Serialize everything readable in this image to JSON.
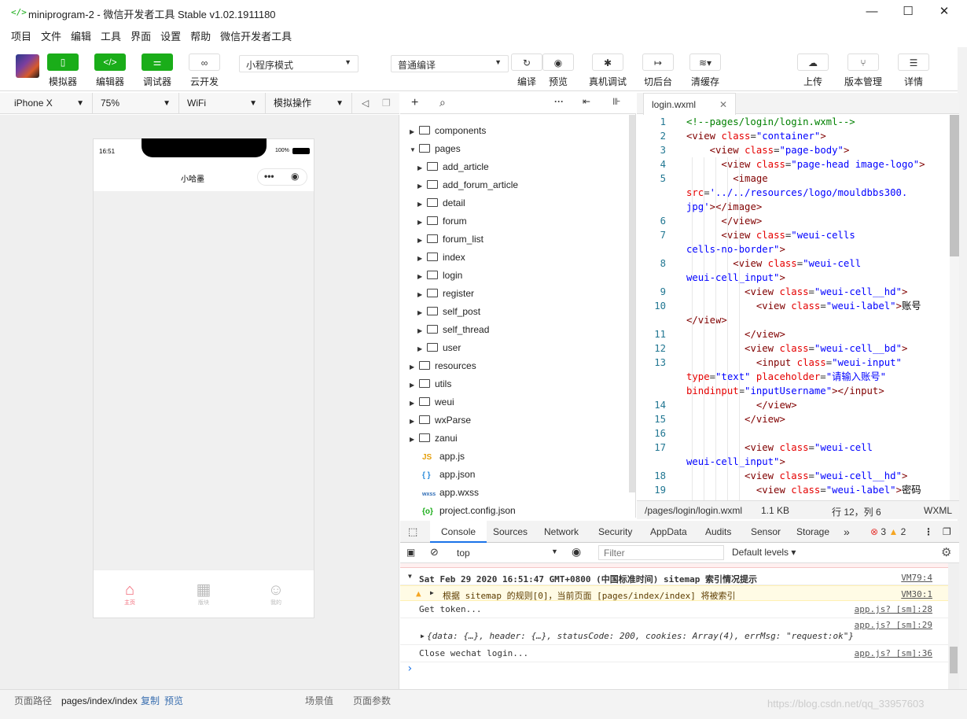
{
  "window": {
    "title": "miniprogram-2 - 微信开发者工具 Stable v1.02.1911180",
    "logo": "</>"
  },
  "menu": [
    "项目",
    "文件",
    "编辑",
    "工具",
    "界面",
    "设置",
    "帮助",
    "微信开发者工具"
  ],
  "toolbar": {
    "simulator": "模拟器",
    "editor": "编辑器",
    "debugger": "调试器",
    "cloud": "云开发",
    "mode": "小程序模式",
    "compile_mode": "普通编译",
    "compile": "编译",
    "preview": "预览",
    "realdebug": "真机调试",
    "background": "切后台",
    "clearcache": "清缓存",
    "upload": "上传",
    "version": "版本管理",
    "details": "详情"
  },
  "sim_header": {
    "device": "iPhone X",
    "zoom": "75%",
    "network": "WiFi",
    "operation": "模拟操作"
  },
  "phone": {
    "time": "16:51",
    "battery": "100%",
    "nav_title": "小哈墨",
    "tabs": [
      {
        "icon": "⌂",
        "label": "主页",
        "active": true
      },
      {
        "icon": "▦",
        "label": "版块",
        "active": false
      },
      {
        "icon": "☺",
        "label": "我的",
        "active": false
      }
    ]
  },
  "filetree": [
    {
      "name": "components",
      "type": "folder",
      "depth": 0,
      "open": false
    },
    {
      "name": "pages",
      "type": "folder",
      "depth": 0,
      "open": true
    },
    {
      "name": "add_article",
      "type": "folder",
      "depth": 1,
      "open": false
    },
    {
      "name": "add_forum_article",
      "type": "folder",
      "depth": 1,
      "open": false
    },
    {
      "name": "detail",
      "type": "folder",
      "depth": 1,
      "open": false
    },
    {
      "name": "forum",
      "type": "folder",
      "depth": 1,
      "open": false
    },
    {
      "name": "forum_list",
      "type": "folder",
      "depth": 1,
      "open": false
    },
    {
      "name": "index",
      "type": "folder",
      "depth": 1,
      "open": false
    },
    {
      "name": "login",
      "type": "folder",
      "depth": 1,
      "open": false
    },
    {
      "name": "register",
      "type": "folder",
      "depth": 1,
      "open": false
    },
    {
      "name": "self_post",
      "type": "folder",
      "depth": 1,
      "open": false
    },
    {
      "name": "self_thread",
      "type": "folder",
      "depth": 1,
      "open": false
    },
    {
      "name": "user",
      "type": "folder",
      "depth": 1,
      "open": false
    },
    {
      "name": "resources",
      "type": "folder",
      "depth": 0,
      "open": false
    },
    {
      "name": "utils",
      "type": "folder",
      "depth": 0,
      "open": false
    },
    {
      "name": "weui",
      "type": "folder",
      "depth": 0,
      "open": false
    },
    {
      "name": "wxParse",
      "type": "folder",
      "depth": 0,
      "open": false
    },
    {
      "name": "zanui",
      "type": "folder",
      "depth": 0,
      "open": false
    },
    {
      "name": "app.js",
      "type": "js",
      "depth": 0,
      "badge": "JS"
    },
    {
      "name": "app.json",
      "type": "json",
      "depth": 0,
      "badge": "{ }"
    },
    {
      "name": "app.wxss",
      "type": "wxss",
      "depth": 0,
      "badge": "wxss"
    },
    {
      "name": "project.config.json",
      "type": "config",
      "depth": 0,
      "badge": "{o}"
    }
  ],
  "editor": {
    "tab": "login.wxml",
    "lines": [
      {
        "n": "1",
        "h": "<span class='c'>&lt;!--pages/login/login.wxml--&gt;</span>"
      },
      {
        "n": "2",
        "h": "<span class='t'>&lt;view</span> <span class='a'>class</span>=<span class='v'>\"container\"</span><span class='t'>&gt;</span>"
      },
      {
        "n": "3",
        "h": "    <span class='t'>&lt;view</span> <span class='a'>class</span>=<span class='v'>\"page-body\"</span><span class='t'>&gt;</span>"
      },
      {
        "n": "4",
        "h": "      <span class='t'>&lt;view</span> <span class='a'>class</span>=<span class='v'>\"page-head image-logo\"</span><span class='t'>&gt;</span>"
      },
      {
        "n": "5",
        "h": "        <span class='t'>&lt;image</span>"
      },
      {
        "n": "",
        "h": "<span class='a'>src</span>=<span class='v'>'../../resources/logo/mouldbbs300.</span>"
      },
      {
        "n": "",
        "h": "<span class='v'>jpg'</span><span class='t'>&gt;&lt;/image&gt;</span>"
      },
      {
        "n": "6",
        "h": "      <span class='t'>&lt;/view&gt;</span>"
      },
      {
        "n": "7",
        "h": "      <span class='t'>&lt;view</span> <span class='a'>class</span>=<span class='v'>\"weui-cells</span>"
      },
      {
        "n": "",
        "h": "<span class='v'>cells-no-border\"</span><span class='t'>&gt;</span>"
      },
      {
        "n": "8",
        "h": "        <span class='t'>&lt;view</span> <span class='a'>class</span>=<span class='v'>\"weui-cell</span>"
      },
      {
        "n": "",
        "h": "<span class='v'>weui-cell_input\"</span><span class='t'>&gt;</span>"
      },
      {
        "n": "9",
        "h": "          <span class='t'>&lt;view</span> <span class='a'>class</span>=<span class='v'>\"weui-cell__hd\"</span><span class='t'>&gt;</span>"
      },
      {
        "n": "10",
        "h": "            <span class='t'>&lt;view</span> <span class='a'>class</span>=<span class='v'>\"weui-label\"</span><span class='t'>&gt;</span><span class='tx'>账号</span>"
      },
      {
        "n": "",
        "h": "<span class='t'>&lt;/view&gt;</span>"
      },
      {
        "n": "11",
        "h": "          <span class='t'>&lt;/view&gt;</span>"
      },
      {
        "n": "12",
        "h": "          <span class='t'>&lt;view</span> <span class='a'>class</span>=<span class='v'>\"weui-cell__bd\"</span><span class='t'>&gt;</span>"
      },
      {
        "n": "13",
        "h": "            <span class='t'>&lt;input</span> <span class='a'>class</span>=<span class='v'>\"weui-input\"</span>"
      },
      {
        "n": "",
        "h": "<span class='a'>type</span>=<span class='v'>\"text\"</span> <span class='a'>placeholder</span>=<span class='v'>\"请输入账号\"</span>"
      },
      {
        "n": "",
        "h": "<span class='a'>bindinput</span>=<span class='v'>\"inputUsername\"</span><span class='t'>&gt;&lt;/input&gt;</span>"
      },
      {
        "n": "14",
        "h": "            <span class='t'>&lt;/view&gt;</span>"
      },
      {
        "n": "15",
        "h": "          <span class='t'>&lt;/view&gt;</span>"
      },
      {
        "n": "16",
        "h": ""
      },
      {
        "n": "17",
        "h": "          <span class='t'>&lt;view</span> <span class='a'>class</span>=<span class='v'>\"weui-cell</span>"
      },
      {
        "n": "",
        "h": "<span class='v'>weui-cell_input\"</span><span class='t'>&gt;</span>"
      },
      {
        "n": "18",
        "h": "          <span class='t'>&lt;view</span> <span class='a'>class</span>=<span class='v'>\"weui-cell__hd\"</span><span class='t'>&gt;</span>"
      },
      {
        "n": "19",
        "h": "            <span class='t'>&lt;view</span> <span class='a'>class</span>=<span class='v'>\"weui-label\"</span><span class='t'>&gt;</span><span class='tx'>密码</span>"
      }
    ],
    "status": {
      "path": "/pages/login/login.wxml",
      "size": "1.1 KB",
      "pos": "行 12，列 6",
      "lang": "WXML"
    }
  },
  "devtools": {
    "tabs": [
      "Console",
      "Sources",
      "Network",
      "Security",
      "AppData",
      "Audits",
      "Sensor",
      "Storage"
    ],
    "more": "»",
    "errors": "3",
    "warnings": "2",
    "context": "top",
    "filter_placeholder": "Filter",
    "levels": "Default levels",
    "console": [
      {
        "text": "Sat Feb 29 2020 16:51:47 GMT+0800 (中国标准时间) sitemap 索引情况提示",
        "src": "VM79:4",
        "kind": "group"
      },
      {
        "text": "根据 sitemap 的规则[0]，当前页面 [pages/index/index] 将被索引",
        "src": "VM30:1",
        "kind": "warn"
      },
      {
        "text": "Get token...",
        "src": "app.js? [sm]:28",
        "kind": "log"
      },
      {
        "text": "{data: {…}, header: {…}, statusCode: 200, cookies: Array(4), errMsg: \"request:ok\"}",
        "src": "app.js? [sm]:29",
        "kind": "obj"
      },
      {
        "text": "Close wechat login...",
        "src": "app.js? [sm]:36",
        "kind": "log"
      }
    ],
    "prompt": "›"
  },
  "statusbar": {
    "path_label": "页面路径",
    "path": "pages/index/index",
    "copy": "复制",
    "preview": "预览",
    "scene": "场景值",
    "params": "页面参数",
    "watermark": "https://blog.csdn.net/qq_33957603"
  }
}
